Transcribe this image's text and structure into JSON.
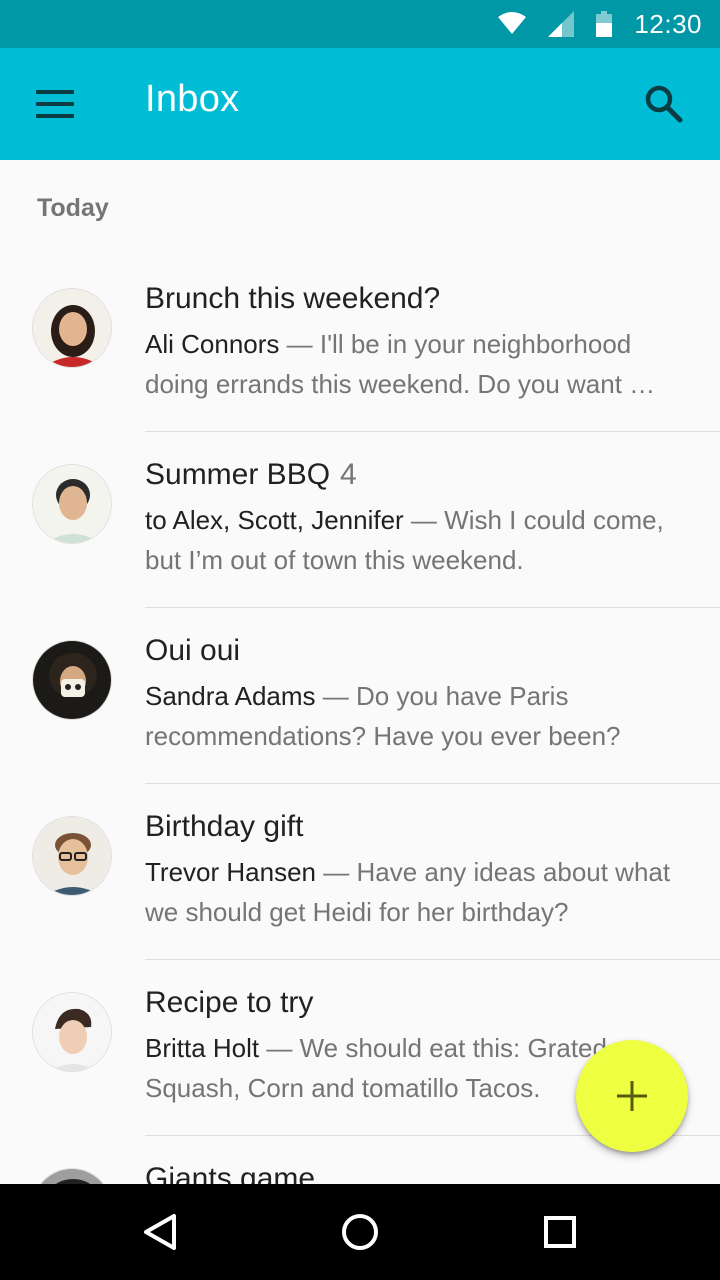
{
  "status_bar": {
    "time": "12:30",
    "icons": [
      "wifi-icon",
      "cell-signal-icon",
      "battery-icon"
    ],
    "color": "#0097a7"
  },
  "app_bar": {
    "title": "Inbox",
    "color": "#00bcd4",
    "menu_icon": "menu-icon",
    "search_icon": "search-icon"
  },
  "section": {
    "label": "Today"
  },
  "messages": [
    {
      "subject": "Brunch this weekend?",
      "count": "",
      "sender": "Ali Connors",
      "separator": " — ",
      "preview": "I'll be in your neighborhood doing errands this weekend. Do you want …"
    },
    {
      "subject": "Summer BBQ",
      "count": "4",
      "sender": "to Alex, Scott, Jennifer",
      "separator": " — ",
      "preview": "Wish I could come, but I’m out of town this weekend."
    },
    {
      "subject": "Oui oui",
      "count": "",
      "sender": "Sandra Adams",
      "separator": " — ",
      "preview": "Do you have Paris recommendations? Have you ever been?"
    },
    {
      "subject": "Birthday gift",
      "count": "",
      "sender": "Trevor Hansen",
      "separator": " — ",
      "preview": "Have any ideas about what we should get Heidi for her birthday?"
    },
    {
      "subject": "Recipe to try",
      "count": "",
      "sender": "Britta Holt",
      "separator": " — ",
      "preview": "We should eat this: Grated Squash, Corn and tomatillo Tacos."
    },
    {
      "subject": "Giants game",
      "count": "",
      "sender": "",
      "separator": "",
      "preview": ""
    }
  ],
  "fab": {
    "icon": "plus-icon",
    "color": "#eeff41"
  },
  "nav_bar": {
    "icons": [
      "back-icon",
      "home-icon",
      "recents-icon"
    ]
  }
}
